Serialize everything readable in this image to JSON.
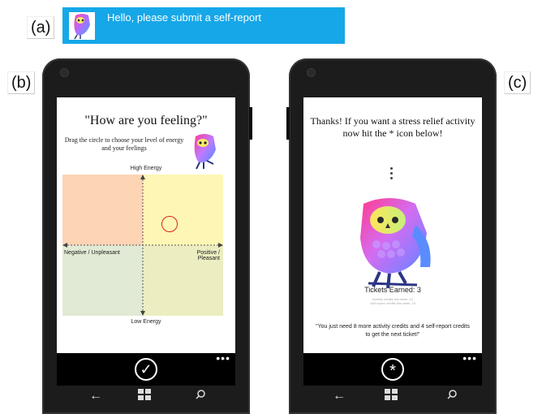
{
  "labels": {
    "a": "(a)",
    "b": "(b)",
    "c": "(c)"
  },
  "banner": {
    "message": "Hello, please submit a self-report"
  },
  "screen_b": {
    "title": "\"How are you feeling?\"",
    "subtitle": "Drag the circle to choose your level of energy and your feelings",
    "high_energy": "High Energy",
    "low_energy": "Low Energy",
    "negative": "Negative / Unpleasant",
    "positive": "Positive / Pleasant",
    "quadrant_colors": [
      "#fdd4b4",
      "#fef6b4",
      "#e1ead4",
      "#ecedc0"
    ],
    "submit_icon": "check-icon"
  },
  "screen_c": {
    "title": "Thanks! If you want a stress relief activity now hit the * icon below!",
    "tickets": "Tickets Earned: 3",
    "activity_credits": "Activity credits this week: 10",
    "selfreport_credits": "Self-report credits this week: 16",
    "quote": "\"You just need 8 more activity credits and 4 self-report credits to get the next ticket!\"",
    "action_icon": "asterisk-icon"
  },
  "nav": {
    "back": "←",
    "windows": "windows-icon",
    "search": "search-icon",
    "more": "•••"
  },
  "colors": {
    "banner": "#16a7e8",
    "phone": "#1c1c1c",
    "circle": "#d22222"
  }
}
